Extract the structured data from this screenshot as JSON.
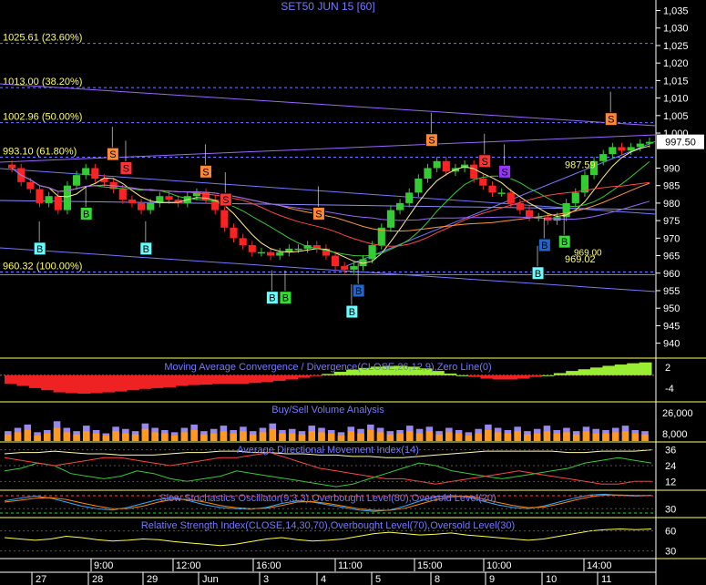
{
  "title": "SET50 JUN 15   [60]",
  "colors": {
    "background": "#000000",
    "up_candle": "#33cc33",
    "down_candle": "#ff2222",
    "axis": "#ffffff",
    "fib_line": "#7777ff",
    "fib_text": "#ffff66",
    "panel_title": "#7777ff",
    "last_price_box": "#ffffff"
  },
  "chart_data": [
    {
      "type": "candlestick",
      "panel": "price",
      "title": "SET50 JUN 15   [60]",
      "ylim": [
        936,
        1038
      ],
      "y_ticks": [
        "1,035",
        "1,030",
        "1,025",
        "1,020",
        "1,015",
        "1,010",
        "1,005",
        "1,000",
        "990",
        "985",
        "980",
        "975",
        "970",
        "965",
        "960",
        "955",
        "950",
        "945",
        "940"
      ],
      "last_price": "997.50",
      "price_labels": [
        "987.59",
        "969.02",
        "969.00"
      ],
      "fibonacci_levels": [
        {
          "label": "1025.61 (23.60%)",
          "value": 1025.61
        },
        {
          "label": "1013.00 (38.20%)",
          "value": 1013.0
        },
        {
          "label": "1002.96 (50.00%)",
          "value": 1002.96
        },
        {
          "label": "993.10 (61.80%)",
          "value": 993.1
        },
        {
          "label": "960.32 (100.00%)",
          "value": 960.32
        }
      ],
      "close": [
        990,
        986,
        984,
        980,
        982,
        978,
        985,
        988,
        990,
        987,
        986,
        984,
        981,
        980,
        978,
        980,
        982,
        981,
        980,
        982,
        983,
        981,
        978,
        973,
        970,
        968,
        966,
        966,
        965,
        966,
        967,
        967,
        968,
        967,
        965,
        962,
        961,
        962,
        964,
        968,
        973,
        978,
        980,
        983,
        987,
        990,
        992,
        989,
        990,
        991,
        987,
        985,
        983,
        983,
        980,
        978,
        976,
        976,
        975,
        976,
        980,
        983,
        988,
        992,
        994,
        996,
        995,
        996,
        997,
        997.5
      ],
      "signals": [
        {
          "label": "B",
          "color": "#66ffff",
          "index": 4,
          "price": 967
        },
        {
          "label": "B",
          "color": "#33dd33",
          "index": 11,
          "price": 977
        },
        {
          "label": "S",
          "color": "#ff8833",
          "index": 15,
          "price": 994
        },
        {
          "label": "S",
          "color": "#ff3333",
          "index": 17,
          "price": 990
        },
        {
          "label": "B",
          "color": "#66ffff",
          "index": 20,
          "price": 967
        },
        {
          "label": "S",
          "color": "#ff8833",
          "index": 29,
          "price": 989
        },
        {
          "label": "S",
          "color": "#ff3333",
          "index": 32,
          "price": 981
        },
        {
          "label": "B",
          "color": "#66ffff",
          "index": 39,
          "price": 953
        },
        {
          "label": "B",
          "color": "#33dd33",
          "index": 41,
          "price": 953
        },
        {
          "label": "S",
          "color": "#ff8833",
          "index": 46,
          "price": 977
        },
        {
          "label": "B",
          "color": "#66ffff",
          "index": 51,
          "price": 949
        },
        {
          "label": "B",
          "color": "#2266cc",
          "index": 52,
          "price": 955
        },
        {
          "label": "S",
          "color": "#ff8833",
          "index": 63,
          "price": 998
        },
        {
          "label": "S",
          "color": "#ff3333",
          "index": 71,
          "price": 992
        },
        {
          "label": "S",
          "color": "#9933ff",
          "index": 74,
          "price": 989
        },
        {
          "label": "B",
          "color": "#66ffff",
          "index": 79,
          "price": 960
        },
        {
          "label": "B",
          "color": "#2266cc",
          "index": 80,
          "price": 968
        },
        {
          "label": "B",
          "color": "#33dd33",
          "index": 83,
          "price": 969
        },
        {
          "label": "S",
          "color": "#ff8833",
          "index": 90,
          "price": 1004
        }
      ]
    },
    {
      "type": "bar-line",
      "panel": "macd",
      "title": "Moving Average Convergence / Divergence(CLOSE,26,12,9),Zero Line(0)",
      "y_ticks": [
        "2",
        "-4"
      ],
      "ylim": [
        -6,
        4
      ],
      "histogram": [
        -2,
        -2.5,
        -3,
        -3.5,
        -4,
        -4.2,
        -4.3,
        -4.2,
        -4,
        -3.8,
        -3.5,
        -3.2,
        -3,
        -2.8,
        -2.5,
        -2.3,
        -2.2,
        -2,
        -2,
        -2,
        -1.8,
        -1.6,
        -1.3,
        -1,
        -0.6,
        -0.2,
        0.3,
        0.8,
        1.3,
        1.7,
        2,
        2.2,
        2.2,
        2,
        1.6,
        1,
        0.4,
        0,
        -0.4,
        -0.8,
        -1,
        -1,
        -0.8,
        -0.4,
        0,
        0.5,
        1,
        1.4,
        1.8,
        2.2,
        2.5,
        2.8,
        3
      ]
    },
    {
      "type": "bar",
      "panel": "volume",
      "title": "Buy/Sell Volume Analysis",
      "y_ticks": [
        "26,000",
        "8,000"
      ],
      "ylim": [
        0,
        34000
      ],
      "buy": [
        9000,
        12000,
        15000,
        8000,
        10000,
        18000,
        12000,
        9000,
        14000,
        10000,
        7000,
        13000,
        11000,
        9000,
        16000,
        12000,
        10000,
        8000,
        12000,
        15000,
        9000,
        11000,
        14000,
        10000,
        13000,
        9000,
        12000,
        16000,
        10000,
        11000,
        9000,
        14000,
        12000,
        10000,
        8000,
        13000,
        11000,
        15000,
        12000,
        9000,
        10000,
        14000,
        11000,
        13000,
        9000,
        12000,
        10000,
        8000,
        11000,
        15000,
        12000,
        10000,
        13000,
        9000,
        11000,
        14000,
        10000,
        12000,
        9000,
        13000,
        11000,
        10000,
        12000,
        14000,
        10000,
        9000
      ],
      "sell": [
        6000,
        8000,
        10000,
        5000,
        7000,
        12000,
        8000,
        6000,
        9000,
        7000,
        5000,
        9000,
        7000,
        6000,
        11000,
        8000,
        7000,
        5000,
        8000,
        10000,
        6000,
        7000,
        9000,
        7000,
        9000,
        6000,
        8000,
        11000,
        7000,
        7000,
        6000,
        9000,
        8000,
        7000,
        5000,
        9000,
        7000,
        10000,
        8000,
        6000,
        7000,
        9000,
        7000,
        9000,
        6000,
        8000,
        7000,
        5000,
        7000,
        10000,
        8000,
        7000,
        9000,
        6000,
        7000,
        9000,
        7000,
        8000,
        6000,
        9000,
        7000,
        7000,
        8000,
        9000,
        7000,
        6000
      ]
    },
    {
      "type": "line",
      "panel": "adx",
      "title": "Average Directional Movement Index(14)",
      "y_ticks": [
        "36",
        "24",
        "12"
      ],
      "ylim": [
        6,
        42
      ],
      "series": [
        {
          "color": "#ffffaa",
          "values": [
            33,
            34,
            34,
            35,
            34,
            33,
            33,
            32,
            32,
            32,
            33,
            34,
            34,
            35,
            35,
            34,
            34,
            33,
            33,
            32,
            32,
            31,
            31,
            30,
            30,
            31,
            32,
            33,
            34,
            35,
            35,
            35,
            35,
            35,
            34,
            34,
            35,
            35,
            35,
            36
          ]
        },
        {
          "color": "#33cc33",
          "values": [
            20,
            22,
            26,
            24,
            18,
            16,
            14,
            16,
            20,
            18,
            14,
            12,
            14,
            16,
            20,
            18,
            16,
            14,
            12,
            10,
            8,
            10,
            14,
            18,
            22,
            26,
            24,
            20,
            18,
            16,
            14,
            16,
            18,
            20,
            22,
            26,
            28,
            30,
            28,
            26
          ]
        },
        {
          "color": "#ff4444",
          "values": [
            30,
            28,
            26,
            24,
            26,
            28,
            30,
            30,
            28,
            26,
            24,
            26,
            28,
            30,
            30,
            32,
            34,
            30,
            26,
            22,
            20,
            18,
            16,
            14,
            14,
            12,
            10,
            12,
            14,
            16,
            18,
            20,
            18,
            16,
            14,
            12,
            10,
            10,
            12,
            12
          ]
        }
      ]
    },
    {
      "type": "line",
      "panel": "stochastic",
      "title": "Slow Stochastics Oscillator(9,3,3),Overbought Level(80),Oversold Level(20)",
      "y_ticks": [
        "30"
      ],
      "ylim": [
        0,
        100
      ],
      "series": [
        {
          "color": "#33aaff",
          "values": [
            60,
            70,
            78,
            70,
            55,
            40,
            30,
            25,
            35,
            50,
            65,
            72,
            60,
            45,
            35,
            30,
            28,
            35,
            50,
            60,
            55,
            45,
            35,
            25,
            20,
            25,
            40,
            60,
            75,
            80,
            75,
            60,
            45,
            35,
            30,
            40,
            55,
            70,
            82,
            85,
            80,
            78,
            80
          ]
        },
        {
          "color": "#ff8800",
          "values": [
            55,
            62,
            70,
            72,
            65,
            52,
            40,
            30,
            30,
            40,
            55,
            66,
            65,
            55,
            42,
            34,
            30,
            32,
            42,
            55,
            57,
            50,
            40,
            30,
            24,
            24,
            32,
            48,
            64,
            75,
            78,
            68,
            54,
            42,
            34,
            36,
            48,
            62,
            75,
            82,
            82,
            80,
            80
          ]
        }
      ]
    },
    {
      "type": "line",
      "panel": "rsi",
      "title": "Relative Strength Index(CLOSE,14,30,70),Overbought Level(70),Oversold Level(30)",
      "y_ticks": [
        "60",
        "30"
      ],
      "ylim": [
        20,
        80
      ],
      "series": [
        {
          "color": "#ffff44",
          "values": [
            50,
            48,
            46,
            48,
            52,
            50,
            47,
            45,
            46,
            48,
            47,
            44,
            42,
            40,
            38,
            40,
            44,
            48,
            50,
            47,
            45,
            46,
            48,
            52,
            56,
            58,
            56,
            54,
            55,
            57,
            54,
            52,
            50,
            48,
            46,
            48,
            52,
            56,
            60,
            62,
            63,
            62,
            63
          ]
        }
      ]
    },
    {
      "type": "axis",
      "panel": "time",
      "time_labels": [
        "9:00",
        "12:00",
        "16:00",
        "11:00",
        "15:00",
        "10:00",
        "14:00"
      ],
      "date_labels": [
        "27",
        "28",
        "29",
        "Jun",
        "3",
        "4",
        "5",
        "8",
        "9",
        "10",
        "11"
      ]
    }
  ]
}
